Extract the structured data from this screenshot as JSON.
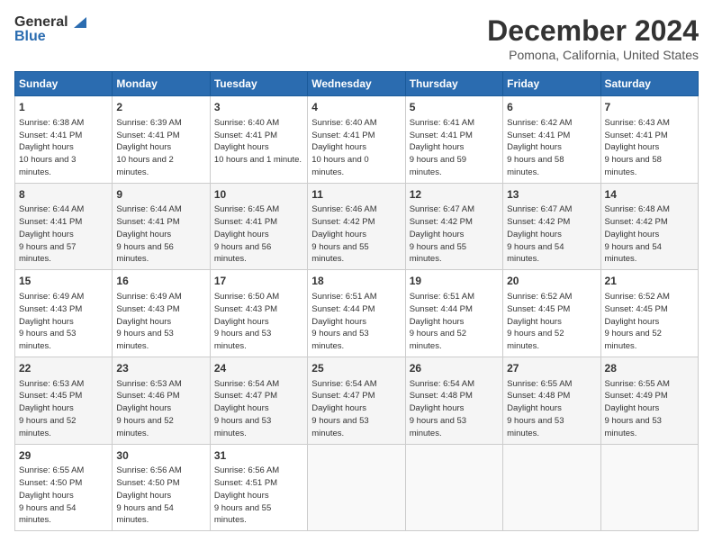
{
  "header": {
    "logo_general": "General",
    "logo_blue": "Blue",
    "month": "December 2024",
    "location": "Pomona, California, United States"
  },
  "days_of_week": [
    "Sunday",
    "Monday",
    "Tuesday",
    "Wednesday",
    "Thursday",
    "Friday",
    "Saturday"
  ],
  "weeks": [
    [
      {
        "day": 1,
        "sunrise": "6:38 AM",
        "sunset": "4:41 PM",
        "daylight": "10 hours and 3 minutes."
      },
      {
        "day": 2,
        "sunrise": "6:39 AM",
        "sunset": "4:41 PM",
        "daylight": "10 hours and 2 minutes."
      },
      {
        "day": 3,
        "sunrise": "6:40 AM",
        "sunset": "4:41 PM",
        "daylight": "10 hours and 1 minute."
      },
      {
        "day": 4,
        "sunrise": "6:40 AM",
        "sunset": "4:41 PM",
        "daylight": "10 hours and 0 minutes."
      },
      {
        "day": 5,
        "sunrise": "6:41 AM",
        "sunset": "4:41 PM",
        "daylight": "9 hours and 59 minutes."
      },
      {
        "day": 6,
        "sunrise": "6:42 AM",
        "sunset": "4:41 PM",
        "daylight": "9 hours and 58 minutes."
      },
      {
        "day": 7,
        "sunrise": "6:43 AM",
        "sunset": "4:41 PM",
        "daylight": "9 hours and 58 minutes."
      }
    ],
    [
      {
        "day": 8,
        "sunrise": "6:44 AM",
        "sunset": "4:41 PM",
        "daylight": "9 hours and 57 minutes."
      },
      {
        "day": 9,
        "sunrise": "6:44 AM",
        "sunset": "4:41 PM",
        "daylight": "9 hours and 56 minutes."
      },
      {
        "day": 10,
        "sunrise": "6:45 AM",
        "sunset": "4:41 PM",
        "daylight": "9 hours and 56 minutes."
      },
      {
        "day": 11,
        "sunrise": "6:46 AM",
        "sunset": "4:42 PM",
        "daylight": "9 hours and 55 minutes."
      },
      {
        "day": 12,
        "sunrise": "6:47 AM",
        "sunset": "4:42 PM",
        "daylight": "9 hours and 55 minutes."
      },
      {
        "day": 13,
        "sunrise": "6:47 AM",
        "sunset": "4:42 PM",
        "daylight": "9 hours and 54 minutes."
      },
      {
        "day": 14,
        "sunrise": "6:48 AM",
        "sunset": "4:42 PM",
        "daylight": "9 hours and 54 minutes."
      }
    ],
    [
      {
        "day": 15,
        "sunrise": "6:49 AM",
        "sunset": "4:43 PM",
        "daylight": "9 hours and 53 minutes."
      },
      {
        "day": 16,
        "sunrise": "6:49 AM",
        "sunset": "4:43 PM",
        "daylight": "9 hours and 53 minutes."
      },
      {
        "day": 17,
        "sunrise": "6:50 AM",
        "sunset": "4:43 PM",
        "daylight": "9 hours and 53 minutes."
      },
      {
        "day": 18,
        "sunrise": "6:51 AM",
        "sunset": "4:44 PM",
        "daylight": "9 hours and 53 minutes."
      },
      {
        "day": 19,
        "sunrise": "6:51 AM",
        "sunset": "4:44 PM",
        "daylight": "9 hours and 52 minutes."
      },
      {
        "day": 20,
        "sunrise": "6:52 AM",
        "sunset": "4:45 PM",
        "daylight": "9 hours and 52 minutes."
      },
      {
        "day": 21,
        "sunrise": "6:52 AM",
        "sunset": "4:45 PM",
        "daylight": "9 hours and 52 minutes."
      }
    ],
    [
      {
        "day": 22,
        "sunrise": "6:53 AM",
        "sunset": "4:45 PM",
        "daylight": "9 hours and 52 minutes."
      },
      {
        "day": 23,
        "sunrise": "6:53 AM",
        "sunset": "4:46 PM",
        "daylight": "9 hours and 52 minutes."
      },
      {
        "day": 24,
        "sunrise": "6:54 AM",
        "sunset": "4:47 PM",
        "daylight": "9 hours and 53 minutes."
      },
      {
        "day": 25,
        "sunrise": "6:54 AM",
        "sunset": "4:47 PM",
        "daylight": "9 hours and 53 minutes."
      },
      {
        "day": 26,
        "sunrise": "6:54 AM",
        "sunset": "4:48 PM",
        "daylight": "9 hours and 53 minutes."
      },
      {
        "day": 27,
        "sunrise": "6:55 AM",
        "sunset": "4:48 PM",
        "daylight": "9 hours and 53 minutes."
      },
      {
        "day": 28,
        "sunrise": "6:55 AM",
        "sunset": "4:49 PM",
        "daylight": "9 hours and 53 minutes."
      }
    ],
    [
      {
        "day": 29,
        "sunrise": "6:55 AM",
        "sunset": "4:50 PM",
        "daylight": "9 hours and 54 minutes."
      },
      {
        "day": 30,
        "sunrise": "6:56 AM",
        "sunset": "4:50 PM",
        "daylight": "9 hours and 54 minutes."
      },
      {
        "day": 31,
        "sunrise": "6:56 AM",
        "sunset": "4:51 PM",
        "daylight": "9 hours and 55 minutes."
      },
      null,
      null,
      null,
      null
    ]
  ]
}
